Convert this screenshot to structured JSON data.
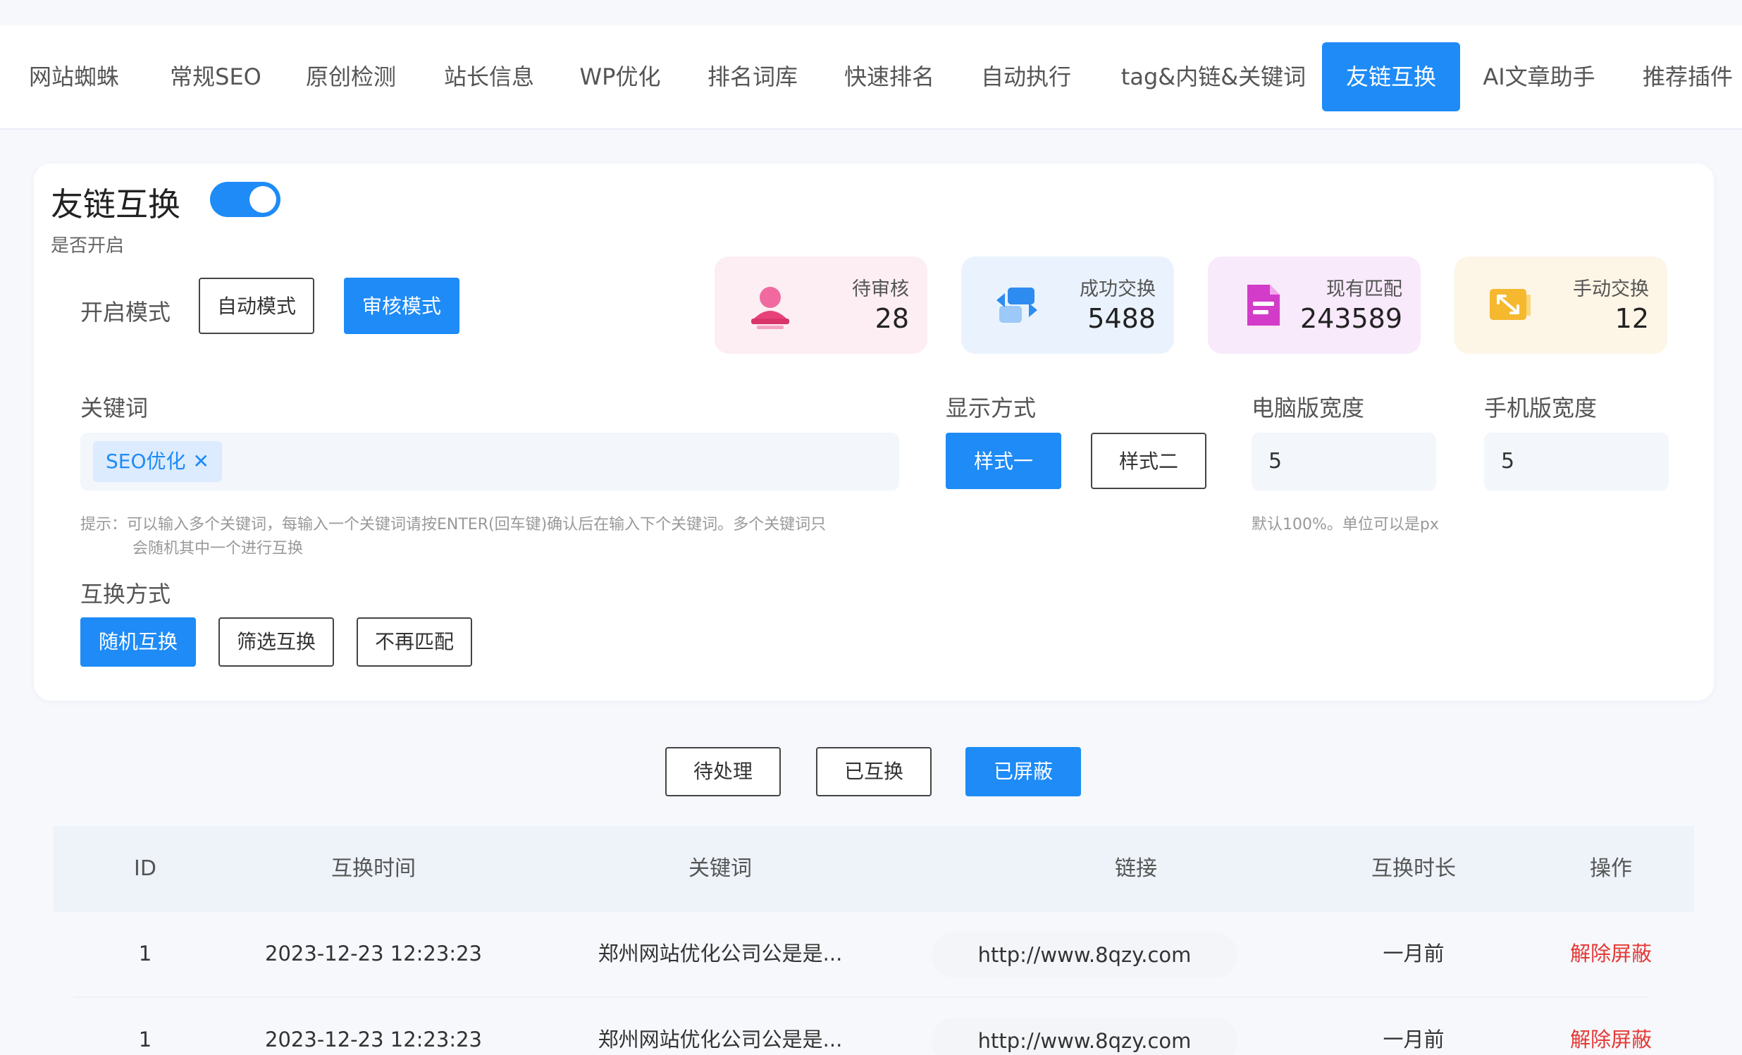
{
  "nav": {
    "tabs": [
      "网站蜘蛛",
      "常规SEO",
      "原创检测",
      "站长信息",
      "WP优化",
      "排名词库",
      "快速排名",
      "自动执行",
      "tag&内链&关键词",
      "友链互换",
      "AI文章助手",
      "推荐插件"
    ],
    "active": "友链互换"
  },
  "settings": {
    "title": "友链互换",
    "toggle_caption": "是否开启",
    "enabled": true,
    "mode_label": "开启模式",
    "modes": [
      "自动模式",
      "审核模式"
    ],
    "selected_mode": "审核模式",
    "keyword_label": "关键词",
    "keyword_chips": [
      "SEO优化"
    ],
    "keyword_hint_line1": "提示：可以输入多个关键词，每输入一个关键词请按ENTER(回车键)确认后在输入下个关键词。多个关键词只",
    "keyword_hint_line2": "会随机其中一个进行互换",
    "display_label": "显示方式",
    "display_styles": [
      "样式一",
      "样式二"
    ],
    "selected_display": "样式一",
    "pc_width_label": "电脑版宽度",
    "pc_width_value": "5",
    "mobile_width_label": "手机版宽度",
    "mobile_width_value": "5",
    "width_hint": "默认100%。单位可以是px",
    "exchange_label": "互换方式",
    "exchange_methods": [
      "随机互换",
      "筛选互换",
      "不再匹配"
    ],
    "selected_exchange": "随机互换"
  },
  "stats": [
    {
      "label": "待审核",
      "value": "28",
      "bg": "#fdeef3",
      "icon": "user-stamp-icon",
      "color": "#e8417a"
    },
    {
      "label": "成功交换",
      "value": "5488",
      "bg": "#eaf3fd",
      "icon": "exchange-arrows-icon",
      "color": "#2d8cf0"
    },
    {
      "label": "现有匹配",
      "value": "243589",
      "bg": "#f8e9fb",
      "icon": "document-icon",
      "color": "#d23cc8"
    },
    {
      "label": "手动交换",
      "value": "12",
      "bg": "#fdf5e6",
      "icon": "resize-arrows-icon",
      "color": "#f5b82e"
    }
  ],
  "filters": {
    "buttons": [
      "待处理",
      "已互换",
      "已屏蔽"
    ],
    "active": "已屏蔽"
  },
  "table": {
    "headers": [
      "ID",
      "互换时间",
      "关键词",
      "链接",
      "互换时长",
      "操作"
    ],
    "rows": [
      {
        "id": "1",
        "time": "2023-12-23 12:23:23",
        "keyword": "郑州网站优化公司公是是...",
        "link": "http://www.8qzy.com",
        "duration": "一月前",
        "action": "解除屏蔽"
      },
      {
        "id": "1",
        "time": "2023-12-23 12:23:23",
        "keyword": "郑州网站优化公司公是是...",
        "link": "http://www.8qzy.com",
        "duration": "一月前",
        "action": "解除屏蔽"
      }
    ]
  }
}
